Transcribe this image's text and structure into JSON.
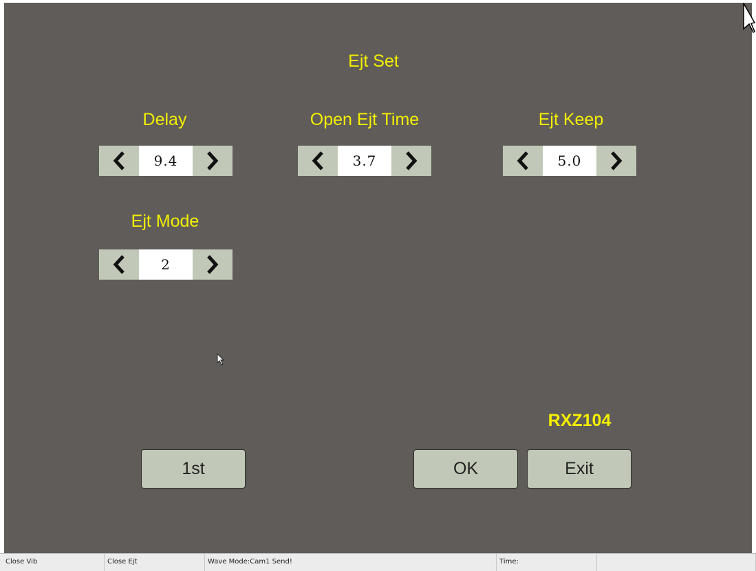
{
  "window": {
    "title": "Ejt Set",
    "model": "RXZ104"
  },
  "settings": {
    "delay": {
      "label": "Delay",
      "value": "9.4"
    },
    "open_ejt_time": {
      "label": "Open Ejt Time",
      "value": "3.7"
    },
    "ejt_keep": {
      "label": "Ejt Keep",
      "value": "5.0"
    },
    "ejt_mode": {
      "label": "Ejt Mode",
      "value": "2"
    }
  },
  "buttons": {
    "first": "1st",
    "ok": "OK",
    "exit": "Exit"
  },
  "statusbar": {
    "cell1": "Close Vib",
    "cell2": "Close Ejt",
    "cell3": "Wave Mode:Cam1  Send!",
    "cell4": "Time:",
    "cell5": ""
  },
  "colors": {
    "panel": "#5f5c59",
    "label": "#f4f000",
    "control": "#c1c8b7"
  },
  "icons": {
    "decrement": "chevron-left-icon",
    "increment": "chevron-right-icon",
    "pointer": "mouse-pointer-icon"
  }
}
